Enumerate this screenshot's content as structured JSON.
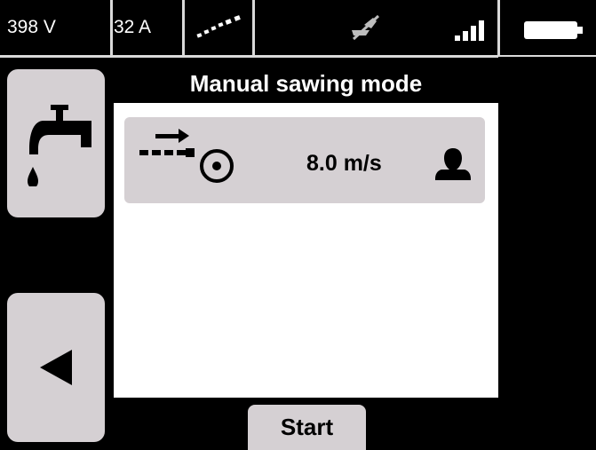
{
  "status": {
    "voltage": "398 V",
    "current": "32 A",
    "icons": [
      "cable-connection-icon",
      "blade-off-icon",
      "signal-strength-icon",
      "battery-icon"
    ]
  },
  "side_buttons": {
    "water": {
      "icon": "water-tap-icon"
    },
    "back": {
      "icon": "back-arrow-icon"
    }
  },
  "main": {
    "title": "Manual sawing mode",
    "speed": {
      "value": "8.0 m/s",
      "feed_icon": "feed-speed-icon",
      "mode_icon": "operator-icon"
    },
    "start_label": "Start"
  },
  "colors": {
    "panel": "#d5d0d3",
    "background": "#000000",
    "content": "#ffffff"
  }
}
